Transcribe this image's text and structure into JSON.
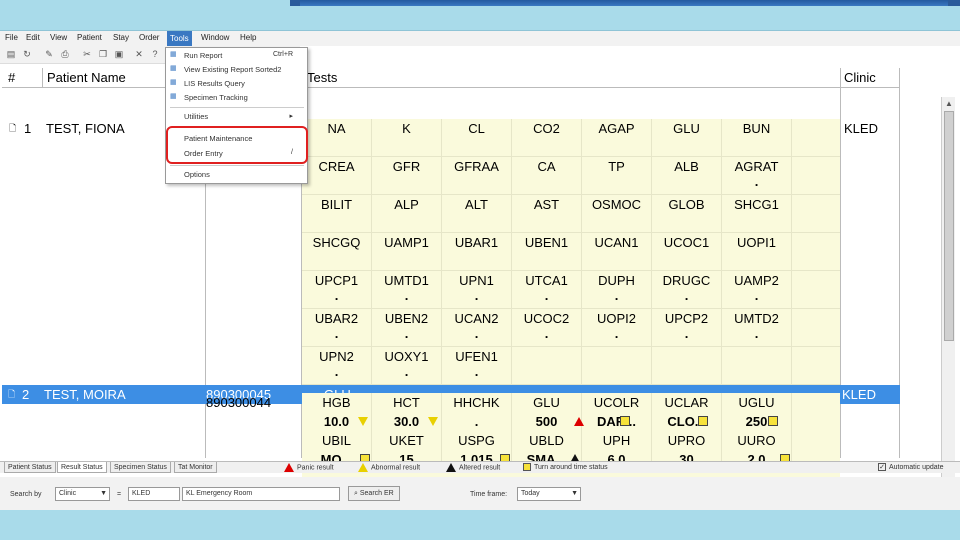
{
  "menu": {
    "items": [
      "File",
      "Edit",
      "View",
      "Patient",
      "Stay",
      "Order",
      "Tools",
      "Window",
      "Help"
    ],
    "active": "Tools"
  },
  "tools_menu": {
    "items": [
      {
        "label": "Run Report",
        "shortcut": "Ctrl+R"
      },
      {
        "label": "View Existing Report Sorted2",
        "shortcut": ""
      },
      {
        "label": "LIS Results Query",
        "shortcut": ""
      },
      {
        "label": "Specimen Tracking",
        "shortcut": ""
      },
      {
        "label": "Utilities",
        "shortcut": "▸"
      },
      {
        "label": "Patient Maintenance",
        "shortcut": ""
      },
      {
        "label": "Order Entry",
        "shortcut": "/"
      },
      {
        "label": "Options",
        "shortcut": ""
      }
    ]
  },
  "grid": {
    "headers": {
      "num": "#",
      "patient": "Patient Name",
      "tests": "Tests",
      "clinic": "Clinic"
    },
    "patient1": {
      "num": "1",
      "name": "TEST, FIONA",
      "clinic": "KLED"
    },
    "patient2": {
      "num": "2",
      "name": "TEST, MOIRA",
      "id": "890300045",
      "test": "GLU",
      "clinic": "KLED"
    },
    "patient2_sub": {
      "id": "890300044"
    },
    "tests_p1": [
      [
        "NA",
        "K",
        "CL",
        "CO2",
        "AGAP",
        "GLU",
        "BUN"
      ],
      [
        "CREA",
        "GFR",
        "GFRAA",
        "CA",
        "TP",
        "ALB",
        "AGRAT"
      ],
      [
        "BILIT",
        "ALP",
        "ALT",
        "AST",
        "OSMOC",
        "GLOB",
        "SHCG1"
      ],
      [
        "SHCGQ",
        "UAMP1",
        "UBAR1",
        "UBEN1",
        "UCAN1",
        "UCOC1",
        "UOPI1"
      ],
      [
        "UPCP1",
        "UMTD1",
        "UPN1",
        "UTCA1",
        "DUPH",
        "DRUGC",
        "UAMP2"
      ],
      [
        "UBAR2",
        "UBEN2",
        "UCAN2",
        "UCOC2",
        "UOPI2",
        "UPCP2",
        "UMTD2"
      ],
      [
        "UPN2",
        "UOXY1",
        "UFEN1",
        "",
        "",
        "",
        ""
      ]
    ],
    "dots_p1": [
      [
        "",
        "",
        "",
        "",
        "",
        "",
        ""
      ],
      [
        "",
        "",
        "",
        "",
        "",
        "",
        "."
      ],
      [
        "",
        "",
        "",
        "",
        "",
        "",
        ""
      ],
      [
        "",
        "",
        "",
        "",
        "",
        "",
        ""
      ],
      [
        ".",
        ".",
        ".",
        ".",
        ".",
        ".",
        "."
      ],
      [
        ".",
        ".",
        ".",
        ".",
        ".",
        ".",
        "."
      ],
      [
        ".",
        ".",
        ".",
        "",
        "",
        "",
        ""
      ]
    ],
    "tests_p2": [
      [
        "HGB",
        "HCT",
        "HHCHK",
        "GLU",
        "UCOLR",
        "UCLAR",
        "UGLU"
      ],
      [
        "10.0",
        "30.0",
        ".",
        "500",
        "DAR...",
        "CLO...",
        "250"
      ],
      [
        "UBIL",
        "UKET",
        "USPG",
        "UBLD",
        "UPH",
        "UPRO",
        "UURO"
      ],
      [
        "MO...",
        "15",
        "1.015",
        "SMA...",
        "6.0",
        "30",
        "2.0"
      ]
    ]
  },
  "bottom_tabs": [
    "Patient Status",
    "Result Status",
    "Specimen Status",
    "Tat Monitor"
  ],
  "legend": [
    {
      "label": "Panic result",
      "kind": "red"
    },
    {
      "label": "Abnormal result",
      "kind": "yellow"
    },
    {
      "label": "Altered result",
      "kind": "black"
    },
    {
      "label": "Turn around time status",
      "kind": "square"
    }
  ],
  "auto_update": "Automatic update",
  "search": {
    "search_by_label": "Search by",
    "search_by_value": "Clinic",
    "eq": "=",
    "clinic_code": "KLED",
    "clinic_name": "KL Emergency Room",
    "search_button": "Search ER",
    "time_frame_label": "Time frame:",
    "time_frame_value": "Today"
  },
  "colors": {
    "selected_row": "#3d8ee4",
    "test_bg": "#fafadc",
    "highlight": "#e02020"
  }
}
